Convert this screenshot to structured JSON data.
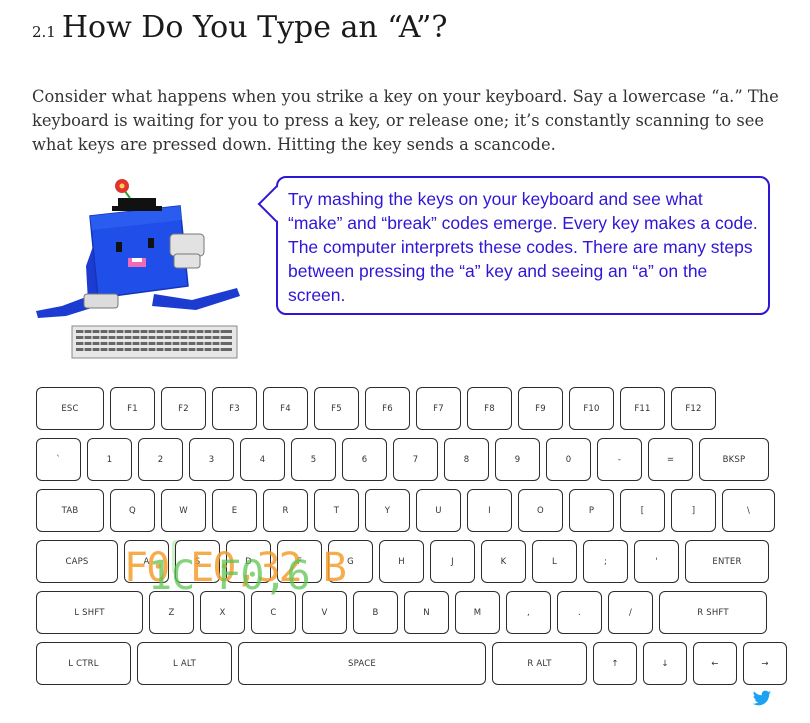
{
  "section": {
    "number": "2.1",
    "title": "How Do You Type an “A”?"
  },
  "intro": "Consider what happens when you strike a key on your keyboard. Say a lowercase “a.” The keyboard is waiting for you to press a key, or release one; it’s constantly scanning to see what keys are pressed down. Hitting the key sends a scancode.",
  "bubble": "Try mashing the keys on your keyboard and see what “make” and “break” codes emerge. Every key makes a code. The computer interprets these codes. There are many steps between pressing the “a” key and seeing an “a” on the screen.",
  "keyboard": {
    "rows": [
      [
        "ESC",
        "F1",
        "F2",
        "F3",
        "F4",
        "F5",
        "F6",
        "F7",
        "F8",
        "F9",
        "F10",
        "F11",
        "F12"
      ],
      [
        "`",
        "1",
        "2",
        "3",
        "4",
        "5",
        "6",
        "7",
        "8",
        "9",
        "0",
        "-",
        "=",
        "BKSP"
      ],
      [
        "TAB",
        "Q",
        "W",
        "E",
        "R",
        "T",
        "Y",
        "U",
        "I",
        "O",
        "P",
        "[",
        "]",
        "\\"
      ],
      [
        "CAPS",
        "A",
        "S",
        "D",
        "F",
        "G",
        "H",
        "J",
        "K",
        "L",
        ";",
        "'",
        "ENTER"
      ],
      [
        "L SHFT",
        "Z",
        "X",
        "C",
        "V",
        "B",
        "N",
        "M",
        ",",
        ".",
        "/",
        "R SHFT"
      ],
      [
        "L CTRL",
        "L ALT",
        "SPACE",
        "R ALT",
        "↑",
        "↓",
        "←",
        "→"
      ]
    ]
  },
  "scancode_overlay": {
    "orange": "F0 E0,32 B",
    "green": "1C F0,6"
  },
  "colors": {
    "accent": "#2e16d8",
    "orange": "#f59e2d",
    "green": "#5cc452"
  },
  "icons": {
    "share": "twitter-icon"
  }
}
